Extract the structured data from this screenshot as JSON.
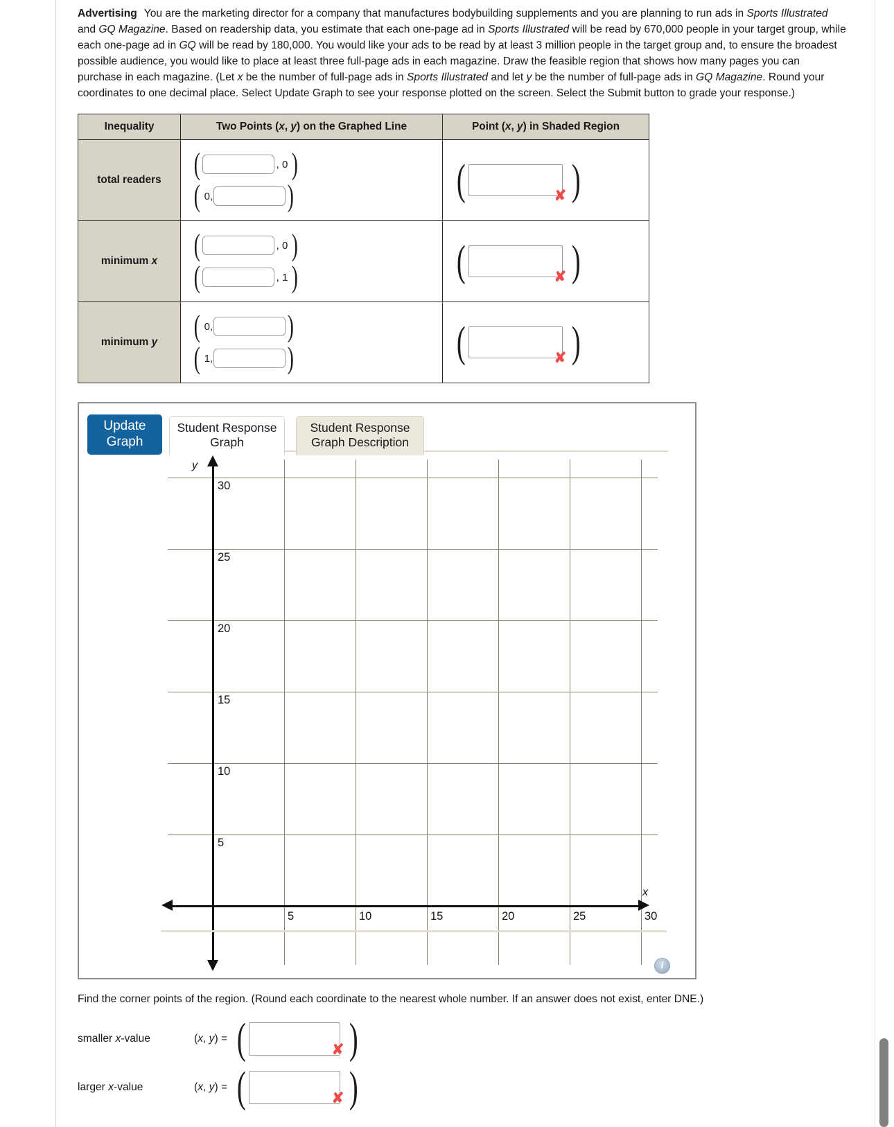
{
  "problem": {
    "lead": "Advertising",
    "paragraph_parts": [
      {
        "t": "You are the marketing director for a company that manufactures bodybuilding supplements and you are planning to run ads in ",
        "i": false
      },
      {
        "t": "Sports Illustrated",
        "i": true
      },
      {
        "t": " and ",
        "i": false
      },
      {
        "t": "GQ Magazine",
        "i": true
      },
      {
        "t": ". Based on readership data, you estimate that each one-page ad in ",
        "i": false
      },
      {
        "t": "Sports Illustrated",
        "i": true
      },
      {
        "t": " will be read by 670,000 people in your target group, while each one-page ad in ",
        "i": false
      },
      {
        "t": "GQ",
        "i": true
      },
      {
        "t": " will be read by 180,000. You would like your ads to be read by at least 3 million people in the target group and, to ensure the broadest possible audience, you would like to place at least three full-page ads in each magazine. Draw the feasible region that shows how many pages you can purchase in each magazine. (Let ",
        "i": false
      },
      {
        "t": "x",
        "i": true
      },
      {
        "t": " be the number of full-page ads in ",
        "i": false
      },
      {
        "t": "Sports Illustrated",
        "i": true
      },
      {
        "t": " and let ",
        "i": false
      },
      {
        "t": "y",
        "i": true
      },
      {
        "t": " be the number of full-page ads in ",
        "i": false
      },
      {
        "t": "GQ Magazine",
        "i": true
      },
      {
        "t": ". Round your coordinates to one decimal place. Select Update Graph to see your response plotted on the screen. Select the Submit button to grade your response.)",
        "i": false
      }
    ]
  },
  "table": {
    "headers": [
      "Inequality",
      "Two Points (x, y) on the Graphed Line",
      "Point (x, y) in Shaded Region"
    ],
    "rows": [
      {
        "label": "total readers",
        "points": [
          {
            "x_value": "",
            "x_fixed": null,
            "y_value": null,
            "y_fixed": "0"
          },
          {
            "x_value": null,
            "x_fixed": "0,",
            "y_value": "",
            "y_fixed": null
          }
        ],
        "shaded": {
          "value": "",
          "status": "incorrect",
          "status_mark": "✘"
        }
      },
      {
        "label": "minimum x",
        "points": [
          {
            "x_value": "",
            "x_fixed": null,
            "y_value": null,
            "y_fixed": "0"
          },
          {
            "x_value": "",
            "x_fixed": null,
            "y_value": null,
            "y_fixed": "1"
          }
        ],
        "shaded": {
          "value": "",
          "status": "incorrect",
          "status_mark": "✘"
        }
      },
      {
        "label": "minimum y",
        "points": [
          {
            "x_value": null,
            "x_fixed": "0,",
            "y_value": "",
            "y_fixed": null
          },
          {
            "x_value": null,
            "x_fixed": "1,",
            "y_value": "",
            "y_fixed": null
          }
        ],
        "shaded": {
          "value": "",
          "status": "incorrect",
          "status_mark": "✘"
        }
      }
    ]
  },
  "graph_panel": {
    "update_button_line1": "Update",
    "update_button_line2": "Graph",
    "tab_graph_line1": "Student Response",
    "tab_graph_line2": "Graph",
    "tab_desc_line1": "Student Response",
    "tab_desc_line2": "Graph Description",
    "info_icon_label": "i",
    "accent_color": "#15639e"
  },
  "chart_data": {
    "type": "scatter",
    "title": "",
    "xlabel": "x",
    "ylabel": "y",
    "xlim": [
      -3,
      30
    ],
    "ylim": [
      -2,
      31
    ],
    "xticks": [
      5,
      10,
      15,
      20,
      25,
      30
    ],
    "yticks": [
      5,
      10,
      15,
      20,
      25,
      30
    ],
    "xtick_labels": [
      "5",
      "10",
      "15",
      "20",
      "25",
      "30"
    ],
    "ytick_labels": [
      "5",
      "10",
      "15",
      "20",
      "25",
      "30"
    ],
    "grid": true,
    "grid_color": "#8b8170",
    "axis_color": "#111111",
    "series": [],
    "annotations": []
  },
  "bottom": {
    "prompt": "Find the corner points of the region. (Round each coordinate to the nearest whole number. If an answer does not exist, enter DNE.)",
    "rows": [
      {
        "label_pre": "smaller ",
        "label_var": "x",
        "label_post": "-value",
        "eq_xy": "(x, y)",
        "eq_sign": " = ",
        "value": "",
        "status_mark": "✘"
      },
      {
        "label_pre": "larger ",
        "label_var": "x",
        "label_post": "-value",
        "eq_xy": "(x, y)",
        "eq_sign": " = ",
        "value": "",
        "status_mark": "✘"
      }
    ]
  }
}
